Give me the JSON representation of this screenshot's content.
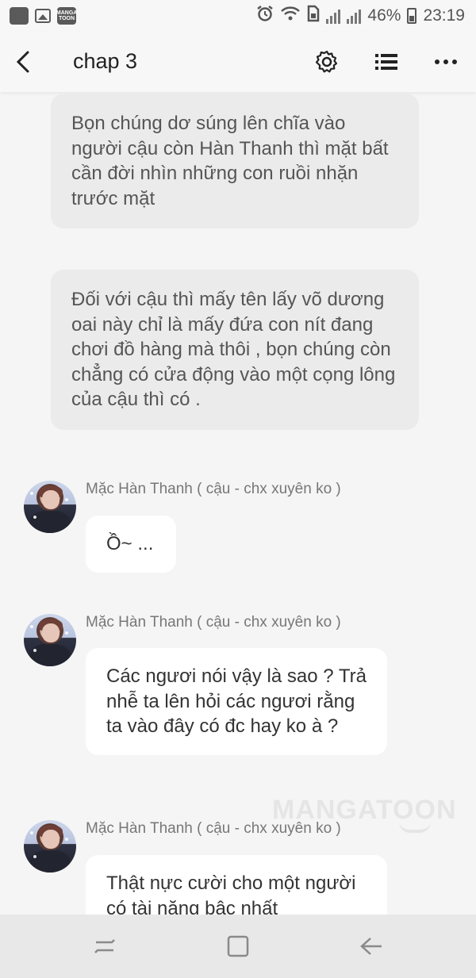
{
  "status_bar": {
    "battery": "46%",
    "time": "23:19",
    "app_icon_label": "MANGA TOON"
  },
  "header": {
    "title": "chap 3",
    "icons": [
      "back-icon",
      "settings-icon",
      "list-icon",
      "more-icon"
    ]
  },
  "messages": [
    {
      "type": "narration",
      "text": "Bọn chúng dơ súng lên chĩa vào người cậu còn Hàn Thanh thì mặt bất cần đời nhìn những con ruồi nhặn trước mặt"
    },
    {
      "type": "narration",
      "text": "Đối với cậu thì mấy tên lấy võ dương oai này chỉ là mấy đứa con nít đang chơi đồ hàng mà thôi , bọn chúng còn chẳng có cửa động vào một cọng lông của cậu thì có ."
    },
    {
      "type": "character",
      "speaker": "Mặc Hàn Thanh ( cậu - chx xuyên ko )",
      "text": "Ồ~ ..."
    },
    {
      "type": "character",
      "speaker": "Mặc Hàn Thanh ( cậu - chx xuyên ko )",
      "text": "Các ngươi nói vậy là sao ? Trả nhễ ta lên hỏi các ngươi rằng ta vào đây có đc hay ko à ?"
    },
    {
      "type": "character",
      "speaker": "Mặc Hàn Thanh ( cậu - chx xuyên ko )",
      "text": "Thật nực cười cho một người có tài năng bậc nhất"
    }
  ],
  "watermark": "MANGATOON",
  "nav_bar": {
    "icons": [
      "recent-apps-icon",
      "home-icon",
      "nav-back-icon"
    ]
  },
  "colors": {
    "narration_bg": "#ebebeb",
    "bubble_bg": "#ffffff",
    "page_bg": "#f5f5f5"
  }
}
